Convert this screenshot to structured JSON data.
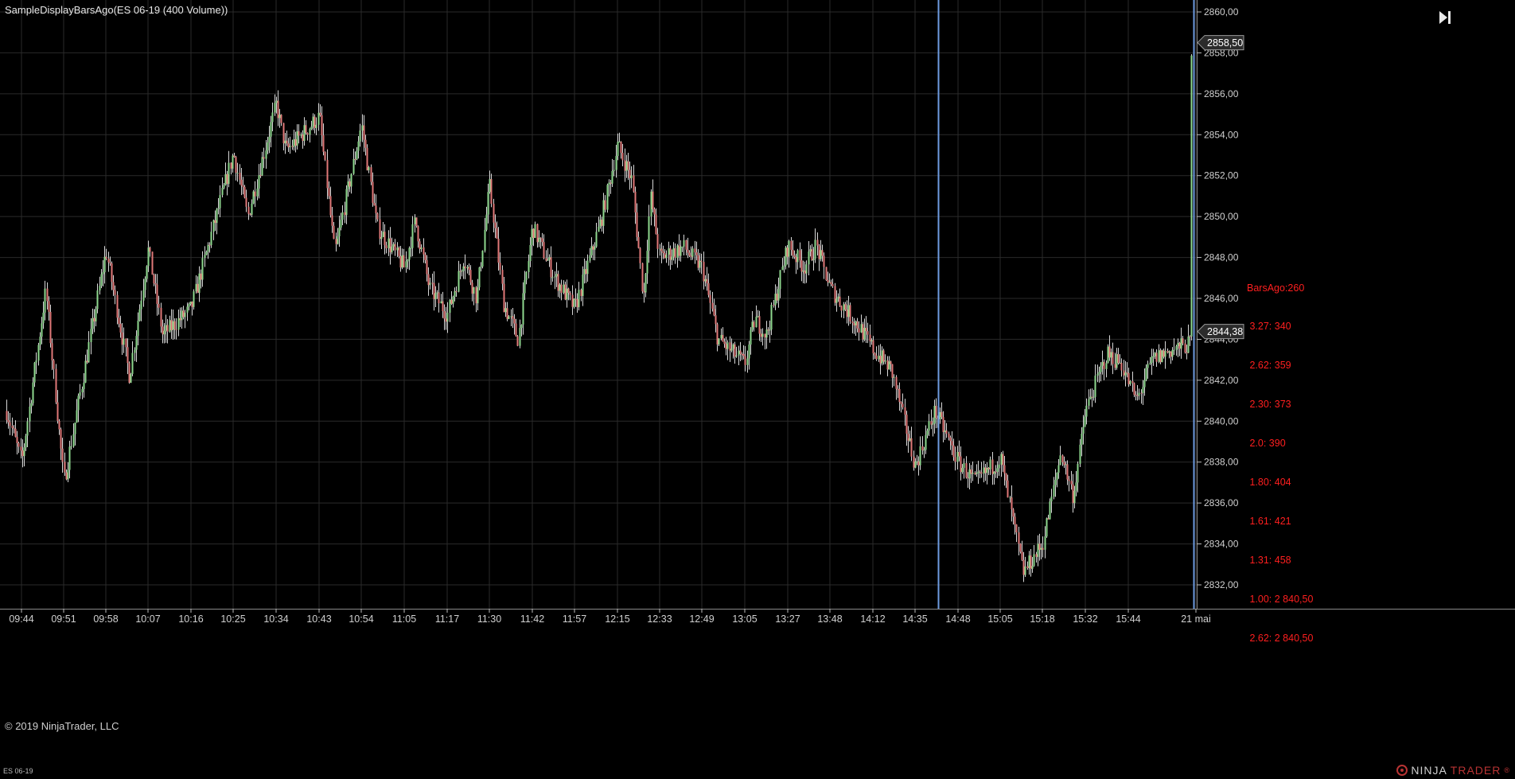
{
  "window": {
    "title": "SampleDisplayBarsAgo(ES 06-19 (400 Volume))",
    "copyright": "© 2019 NinjaTrader, LLC",
    "instrument_small": "ES 06-19",
    "logo_text_1": "NINJA",
    "logo_text_2": "TRADER",
    "logo_registered": "®"
  },
  "annotation": {
    "lines": [
      "BarsAgo:260",
      " 3.27: 340",
      " 2.62: 359",
      " 2.30: 373",
      " 2.0: 390",
      " 1.80: 404",
      " 1.61: 421",
      " 1.31: 458",
      " 1.00: 2 840,50",
      " 2.62: 2 840,50"
    ],
    "color": "#ff1f1f"
  },
  "price_axis": {
    "ticks": [
      "2860,00",
      "2858,00",
      "2856,00",
      "2854,00",
      "2852,00",
      "2850,00",
      "2848,00",
      "2846,00",
      "2844,00",
      "2842,00",
      "2840,00",
      "2838,00",
      "2836,00",
      "2834,00",
      "2832,00"
    ],
    "last_price": "2858,50",
    "marker_price": "2844,38"
  },
  "time_axis": {
    "ticks": [
      "09:44",
      "09:51",
      "09:58",
      "10:07",
      "10:16",
      "10:25",
      "10:34",
      "10:43",
      "10:54",
      "11:05",
      "11:17",
      "11:30",
      "11:42",
      "11:57",
      "12:15",
      "12:33",
      "12:49",
      "13:05",
      "13:27",
      "13:48",
      "14:12",
      "14:35",
      "14:48",
      "15:05",
      "15:18",
      "15:32",
      "15:44",
      "21 mai"
    ]
  },
  "colors": {
    "background": "#000000",
    "grid": "#2a2a2a",
    "up_bar": "#8ed88e",
    "down_bar": "#e07878",
    "wick": "#d8d8d8",
    "vertical_line": "#6e9be0",
    "annotation": "#ff1f1f"
  },
  "chart_data": {
    "type": "candlestick",
    "title": "SampleDisplayBarsAgo(ES 06-19 (400 Volume))",
    "ylim": [
      2831,
      2860.5
    ],
    "y_ticks": [
      2860,
      2858,
      2856,
      2854,
      2852,
      2850,
      2848,
      2846,
      2844,
      2842,
      2840,
      2838,
      2836,
      2834,
      2832
    ],
    "x_ticks": [
      "09:44",
      "09:51",
      "09:58",
      "10:07",
      "10:16",
      "10:25",
      "10:34",
      "10:43",
      "10:54",
      "11:05",
      "11:17",
      "11:30",
      "11:42",
      "11:57",
      "12:15",
      "12:33",
      "12:49",
      "13:05",
      "13:27",
      "13:48",
      "14:12",
      "14:35",
      "14:48",
      "15:05",
      "15:18",
      "15:32",
      "15:44",
      "21 mai"
    ],
    "path_anchors": [
      [
        "start",
        2840.5
      ],
      [
        "09:44",
        2838.0
      ],
      [
        "09:48",
        2846.4
      ],
      [
        "09:51",
        2837.0
      ],
      [
        "09:58",
        2848.3
      ],
      [
        "10:03",
        2842.2
      ],
      [
        "10:07",
        2848.4
      ],
      [
        "10:10",
        2844.2
      ],
      [
        "10:16",
        2845.5
      ],
      [
        "10:25",
        2853.1
      ],
      [
        "10:28",
        2850.0
      ],
      [
        "10:34",
        2855.5
      ],
      [
        "10:36",
        2853.2
      ],
      [
        "10:43",
        2854.9
      ],
      [
        "10:47",
        2848.2
      ],
      [
        "10:54",
        2854.5
      ],
      [
        "10:58",
        2849.5
      ],
      [
        "11:05",
        2847.5
      ],
      [
        "11:08",
        2849.8
      ],
      [
        "11:12",
        2846.5
      ],
      [
        "11:17",
        2845.2
      ],
      [
        "11:22",
        2848.0
      ],
      [
        "11:26",
        2846.0
      ],
      [
        "11:30",
        2851.5
      ],
      [
        "11:34",
        2845.7
      ],
      [
        "11:38",
        2844.0
      ],
      [
        "11:42",
        2849.5
      ],
      [
        "11:50",
        2847.0
      ],
      [
        "11:57",
        2845.5
      ],
      [
        "12:08",
        2849.8
      ],
      [
        "12:15",
        2853.5
      ],
      [
        "12:21",
        2851.8
      ],
      [
        "12:26",
        2846.0
      ],
      [
        "12:29",
        2851.0
      ],
      [
        "12:33",
        2848.0
      ],
      [
        "12:42",
        2848.5
      ],
      [
        "12:49",
        2847.5
      ],
      [
        "12:55",
        2844.0
      ],
      [
        "13:05",
        2842.8
      ],
      [
        "13:10",
        2845.0
      ],
      [
        "13:16",
        2844.2
      ],
      [
        "13:27",
        2848.6
      ],
      [
        "13:35",
        2847.5
      ],
      [
        "13:41",
        2848.6
      ],
      [
        "13:48",
        2846.5
      ],
      [
        "14:05",
        2844.5
      ],
      [
        "14:12",
        2843.5
      ],
      [
        "14:22",
        2842.5
      ],
      [
        "14:35",
        2837.8
      ],
      [
        "14:41",
        2840.5
      ],
      [
        "14:48",
        2838.0
      ],
      [
        "14:55",
        2837.0
      ],
      [
        "15:05",
        2838.2
      ],
      [
        "15:12",
        2832.6
      ],
      [
        "15:18",
        2834.0
      ],
      [
        "15:24",
        2838.5
      ],
      [
        "15:28",
        2836.3
      ],
      [
        "15:32",
        2840.5
      ],
      [
        "15:38",
        2843.3
      ],
      [
        "15:42",
        2842.8
      ],
      [
        "15:46",
        2841.0
      ],
      [
        "15:50",
        2843.0
      ],
      [
        "15:55",
        2843.5
      ],
      [
        "16:00",
        2843.8
      ],
      [
        "21 mai",
        2858.5
      ]
    ],
    "vertical_lines": [
      "14:42",
      "16:00"
    ],
    "last_price": 2858.5,
    "marker_price": 2844.38,
    "bars_ago": 260
  }
}
